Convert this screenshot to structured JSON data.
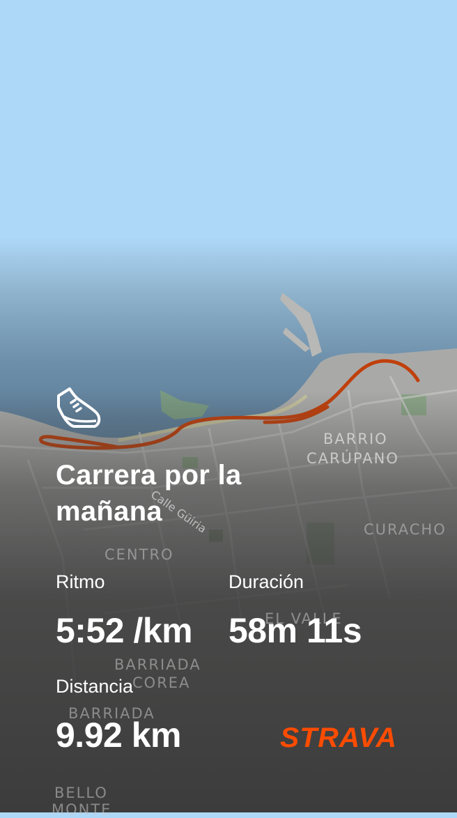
{
  "activity": {
    "title": "Carrera por la mañana",
    "icon": "running-shoe-icon"
  },
  "stats": {
    "pace_label": "Ritmo",
    "pace_value": "5:52 /km",
    "duration_label": "Duración",
    "duration_value": "58m 11s",
    "distance_label": "Distancia",
    "distance_value": "9.92 km"
  },
  "brand": {
    "name": "STRAVA",
    "color": "#fc4c02"
  },
  "map": {
    "route_color": "#c0400c",
    "places": [
      "BARRIO",
      "CARÚPANO",
      "CURACHO",
      "CENTRO",
      "EL VALLE",
      "BARRIADA",
      "COREA",
      "BARRIADA",
      "BELLO",
      "MONTE",
      "Calle Güiria"
    ]
  }
}
